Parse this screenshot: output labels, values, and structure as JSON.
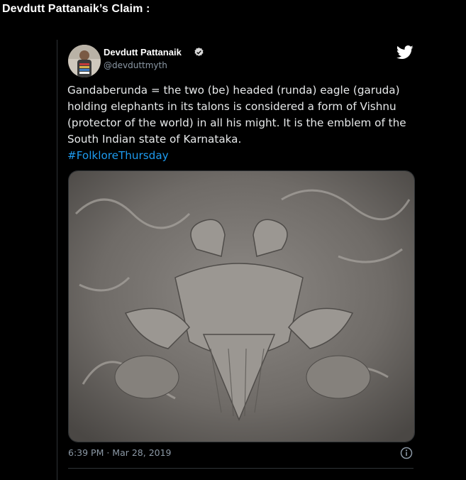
{
  "heading": "Devdutt Pattanaik’s Claim :",
  "tweet": {
    "author_name": "Devdutt Pattanaik",
    "handle": "@devduttmyth",
    "text": "Gandaberunda = the two (be) headed (runda) eagle (garuda) holding elephants in its talons is considered a form of Vishnu (protector of the world) in all his might. It is the emblem of the South Indian state of Karnataka.",
    "hashtag": "#FolkloreThursday",
    "timestamp": "6:39 PM · Mar 28, 2019"
  },
  "icons": {
    "verified": "verified-badge-icon",
    "twitter": "twitter-bird-icon",
    "info": "info-icon"
  },
  "colors": {
    "background": "#000000",
    "text": "#e7e9ea",
    "muted": "#8b98a5",
    "link": "#1d9bf0",
    "twitter_bird": "#ffffff"
  }
}
